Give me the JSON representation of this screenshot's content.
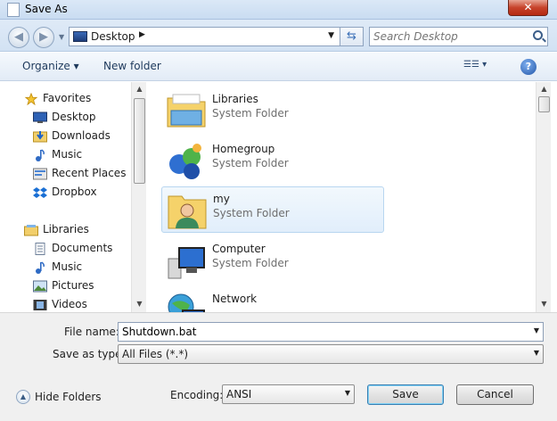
{
  "window": {
    "title": "Save As",
    "close_label": "✕"
  },
  "nav": {
    "back_glyph": "◀",
    "forward_glyph": "▶",
    "address": {
      "location": "Desktop",
      "separator": "▶"
    },
    "search_placeholder": "Search Desktop"
  },
  "toolbar": {
    "organize_label": "Organize ▾",
    "new_folder_label": "New folder",
    "view_label": "☰☰ ▾",
    "help_label": "?"
  },
  "sidebar": {
    "items": [
      {
        "label": "Favorites",
        "icon": "star-icon"
      },
      {
        "label": "Desktop",
        "icon": "desktop-icon"
      },
      {
        "label": "Downloads",
        "icon": "downloads-icon"
      },
      {
        "label": "Music",
        "icon": "music-icon"
      },
      {
        "label": "Recent Places",
        "icon": "recent-places-icon"
      },
      {
        "label": "Dropbox",
        "icon": "dropbox-icon"
      },
      {
        "label": "Libraries",
        "icon": "libraries-icon"
      },
      {
        "label": "Documents",
        "icon": "documents-icon"
      },
      {
        "label": "Music",
        "icon": "music-icon"
      },
      {
        "label": "Pictures",
        "icon": "pictures-icon"
      },
      {
        "label": "Videos",
        "icon": "videos-icon"
      }
    ]
  },
  "files": {
    "items": [
      {
        "name": "Libraries",
        "type": "System Folder",
        "icon": "libraries-folder-icon"
      },
      {
        "name": "Homegroup",
        "type": "System Folder",
        "icon": "homegroup-icon"
      },
      {
        "name": "my",
        "type": "System Folder",
        "icon": "user-folder-icon",
        "selected": true
      },
      {
        "name": "Computer",
        "type": "System Folder",
        "icon": "computer-icon"
      },
      {
        "name": "Network",
        "type": "",
        "icon": "network-icon"
      }
    ]
  },
  "form": {
    "file_name_label": "File name:",
    "file_name_value": "Shutdown.bat",
    "save_type_label": "Save as type:",
    "save_type_value": "All Files  (*.*)",
    "encoding_label": "Encoding:",
    "encoding_value": "ANSI",
    "hide_folders_label": "Hide Folders",
    "save_label": "Save",
    "cancel_label": "Cancel"
  }
}
